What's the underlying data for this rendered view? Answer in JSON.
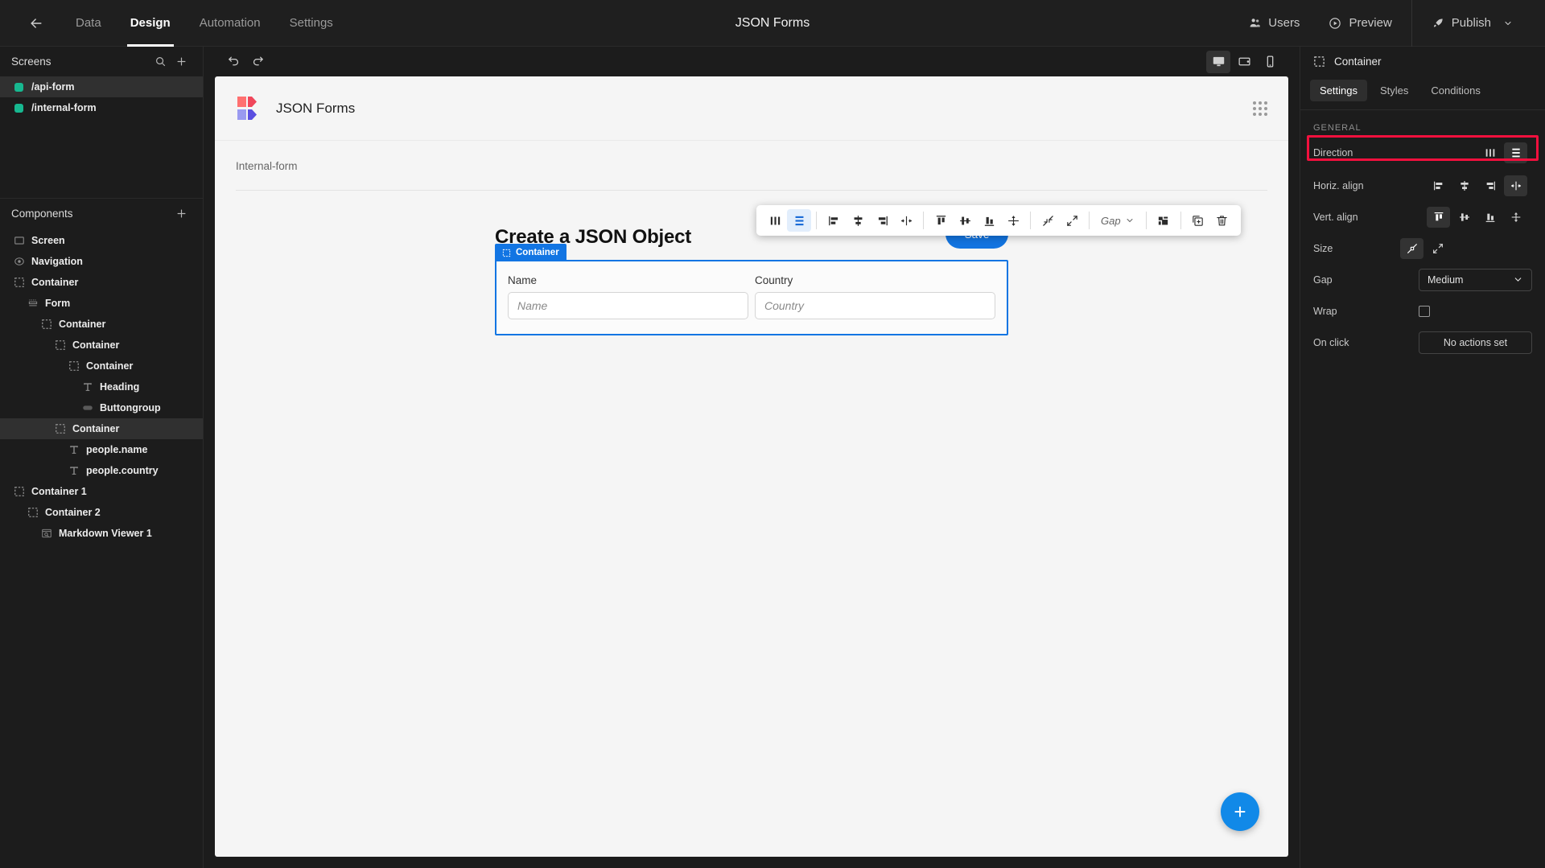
{
  "topbar": {
    "back_icon": "arrow-left-icon",
    "tabs": [
      {
        "label": "Data",
        "active": false
      },
      {
        "label": "Design",
        "active": true
      },
      {
        "label": "Automation",
        "active": false
      },
      {
        "label": "Settings",
        "active": false
      }
    ],
    "title": "JSON Forms",
    "users_label": "Users",
    "preview_label": "Preview",
    "publish_label": "Publish"
  },
  "left_panel": {
    "screens_title": "Screens",
    "screens": [
      {
        "label": "/api-form",
        "active": true,
        "color": "#17b890"
      },
      {
        "label": "/internal-form",
        "active": false,
        "color": "#17b890"
      }
    ],
    "components_title": "Components",
    "tree": [
      {
        "label": "Screen",
        "depth": 0,
        "icon": "screen-icon",
        "selected": false
      },
      {
        "label": "Navigation",
        "depth": 0,
        "icon": "navigation-icon",
        "selected": false
      },
      {
        "label": "Container",
        "depth": 0,
        "icon": "container-icon",
        "selected": false
      },
      {
        "label": "Form",
        "depth": 1,
        "icon": "form-icon",
        "selected": false
      },
      {
        "label": "Container",
        "depth": 2,
        "icon": "container-icon",
        "selected": false
      },
      {
        "label": "Container",
        "depth": 3,
        "icon": "container-icon",
        "selected": false
      },
      {
        "label": "Container",
        "depth": 4,
        "icon": "container-icon",
        "selected": false
      },
      {
        "label": "Heading",
        "depth": 5,
        "icon": "text-icon",
        "selected": false
      },
      {
        "label": "Buttongroup",
        "depth": 5,
        "icon": "buttongroup-icon",
        "selected": false
      },
      {
        "label": "Container",
        "depth": 3,
        "icon": "container-icon",
        "selected": true
      },
      {
        "label": "people.name",
        "depth": 4,
        "icon": "text-icon",
        "selected": false
      },
      {
        "label": "people.country",
        "depth": 4,
        "icon": "text-icon",
        "selected": false
      },
      {
        "label": "Container 1",
        "depth": 0,
        "icon": "container-icon",
        "selected": false
      },
      {
        "label": "Container 2",
        "depth": 1,
        "icon": "container-icon",
        "selected": false
      },
      {
        "label": "Markdown Viewer 1",
        "depth": 2,
        "icon": "markdown-icon",
        "selected": false
      }
    ]
  },
  "center": {
    "undo_icon": "undo-icon",
    "redo_icon": "redo-icon",
    "devices": [
      {
        "name": "desktop",
        "active": true
      },
      {
        "name": "tablet",
        "active": false
      },
      {
        "name": "mobile",
        "active": false
      }
    ],
    "canvas": {
      "logo_text": "JSON Forms",
      "breadcrumb": "Internal-form",
      "form_title": "Create a JSON Object",
      "save_label": "Save",
      "selection_badge": "Container",
      "fields": [
        {
          "label": "Name",
          "placeholder": "Name",
          "value": ""
        },
        {
          "label": "Country",
          "placeholder": "Country",
          "value": ""
        }
      ],
      "fab_label": "+"
    },
    "float_toolbar": {
      "gap_label": "Gap",
      "buttons": [
        {
          "name": "direction-horizontal",
          "active": false
        },
        {
          "name": "direction-vertical",
          "active": true
        },
        {
          "name": "align-left",
          "active": false
        },
        {
          "name": "align-center",
          "active": false
        },
        {
          "name": "align-right",
          "active": false
        },
        {
          "name": "align-space-between",
          "active": false
        },
        {
          "name": "valign-top",
          "active": false
        },
        {
          "name": "valign-middle",
          "active": false
        },
        {
          "name": "valign-bottom",
          "active": false
        },
        {
          "name": "valign-stretch",
          "active": false
        },
        {
          "name": "size-shrink",
          "active": false
        },
        {
          "name": "size-grow",
          "active": false
        },
        {
          "name": "layout-grid",
          "active": false
        },
        {
          "name": "duplicate",
          "active": false
        },
        {
          "name": "delete",
          "active": false
        }
      ]
    }
  },
  "right_panel": {
    "title": "Container",
    "tabs": [
      {
        "label": "Settings",
        "active": true
      },
      {
        "label": "Styles",
        "active": false
      },
      {
        "label": "Conditions",
        "active": false
      }
    ],
    "section_title": "GENERAL",
    "props": {
      "direction_label": "Direction",
      "direction_options": [
        "horizontal",
        "vertical"
      ],
      "direction_selected": "vertical",
      "horiz_label": "Horiz. align",
      "horiz_options": [
        "left",
        "center",
        "right",
        "space-between"
      ],
      "horiz_selected": "space-between",
      "vert_label": "Vert. align",
      "vert_options": [
        "top",
        "middle",
        "bottom",
        "stretch"
      ],
      "vert_selected": "top",
      "size_label": "Size",
      "size_options": [
        "shrink",
        "grow"
      ],
      "size_selected": "shrink",
      "gap_label": "Gap",
      "gap_value": "Medium",
      "wrap_label": "Wrap",
      "wrap_checked": false,
      "onclick_label": "On click",
      "onclick_value": "No actions set"
    },
    "highlight_color": "#f2103e"
  }
}
